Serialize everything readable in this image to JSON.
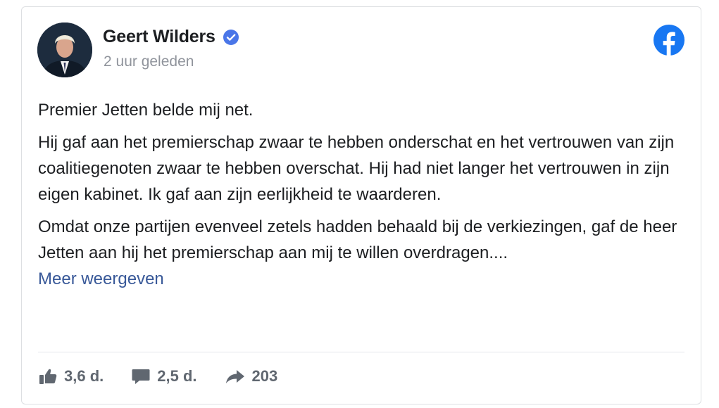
{
  "author": {
    "name": "Geert Wilders",
    "verified": true,
    "timestamp": "2 uur geleden"
  },
  "brand": {
    "icon": "facebook-icon",
    "color": "#1877f2"
  },
  "post": {
    "paragraphs": [
      "Premier Jetten belde mij net.",
      "Hij gaf aan het premierschap zwaar te hebben onderschat en het vertrouwen van zijn coalitiegenoten zwaar te hebben overschat. Hij had niet langer het vertrouwen in zijn eigen kabinet. Ik gaf aan zijn eerlijkheid te waarderen.",
      "Omdat onze partijen evenveel zetels hadden behaald bij de verkiezingen, gaf de heer Jetten aan hij het premierschap aan mij te willen overdragen...."
    ],
    "see_more": "Meer weergeven"
  },
  "stats": {
    "likes": {
      "icon": "thumbs-up-icon",
      "count": "3,6 d."
    },
    "comments": {
      "icon": "comment-icon",
      "count": "2,5 d."
    },
    "shares": {
      "icon": "share-arrow-icon",
      "count": "203"
    }
  },
  "colors": {
    "text": "#1c1e21",
    "secondary": "#90949c",
    "link": "#385898",
    "verified": "#4a76e8",
    "stat": "#606770"
  }
}
